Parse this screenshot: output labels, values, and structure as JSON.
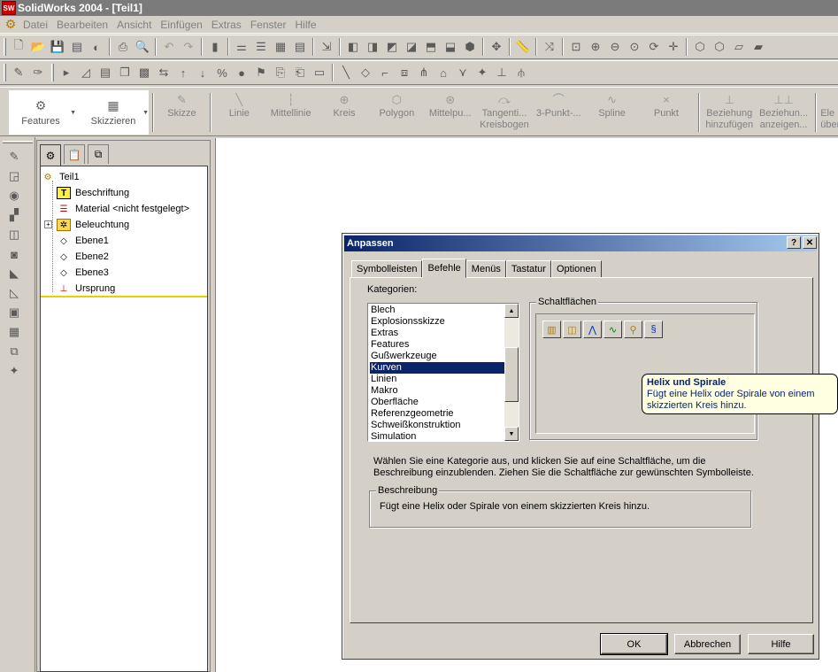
{
  "app": {
    "title": "SolidWorks 2004 - [Teil1]",
    "logo_text": "SW"
  },
  "menu": [
    "Datei",
    "Bearbeiten",
    "Ansicht",
    "Einfügen",
    "Extras",
    "Fenster",
    "Hilfe"
  ],
  "command_manager": {
    "features": "Features",
    "sketch": "Skizzieren",
    "buttons": [
      {
        "label": "Skizze",
        "label2": ""
      },
      {
        "label": "Linie",
        "label2": ""
      },
      {
        "label": "Mittellinie",
        "label2": ""
      },
      {
        "label": "Kreis",
        "label2": ""
      },
      {
        "label": "Polygon",
        "label2": ""
      },
      {
        "label": "Mittelpu...",
        "label2": ""
      },
      {
        "label": "Tangenti...",
        "label2": "Kreisbogen"
      },
      {
        "label": "3-Punkt-...",
        "label2": ""
      },
      {
        "label": "Spline",
        "label2": ""
      },
      {
        "label": "Punkt",
        "label2": ""
      },
      {
        "label": "Beziehung",
        "label2": "hinzufügen"
      },
      {
        "label": "Beziehun...",
        "label2": "anzeigen..."
      },
      {
        "label": "Ele",
        "label2": "über"
      }
    ]
  },
  "feature_tree": {
    "root": "Teil1",
    "items": [
      "Beschriftung",
      "Material <nicht festgelegt>",
      "Beleuchtung",
      "Ebene1",
      "Ebene2",
      "Ebene3",
      "Ursprung"
    ]
  },
  "dialog": {
    "title": "Anpassen",
    "help_btn": "?",
    "close_btn": "✕",
    "tabs": [
      "Symbolleisten",
      "Befehle",
      "Menüs",
      "Tastatur",
      "Optionen"
    ],
    "active_tab": "Befehle",
    "categories_label": "Kategorien:",
    "categories": [
      "Blech",
      "Explosionsskizze",
      "Extras",
      "Features",
      "Gußwerkzeuge",
      "Kurven",
      "Linien",
      "Makro",
      "Oberfläche",
      "Referenzgeometrie",
      "Schweißkonstruktion",
      "Simulation"
    ],
    "selected_category": "Kurven",
    "buttons_label": "Schaltflächen",
    "tooltip": {
      "title": "Helix und Spirale",
      "text": "Fügt eine Helix oder Spirale von einem skizzierten Kreis hinzu."
    },
    "instructions_line1": "Wählen Sie eine Kategorie aus, und klicken Sie auf eine Schaltfläche, um die",
    "instructions_line2": "Beschreibung einzublenden. Ziehen Sie die Schaltfläche zur gewünschten Symbolleiste.",
    "description_label": "Beschreibung",
    "description_text": "Fügt eine Helix oder Spirale von einem skizzierten Kreis hinzu.",
    "ok": "OK",
    "cancel": "Abbrechen",
    "help": "Hilfe"
  }
}
